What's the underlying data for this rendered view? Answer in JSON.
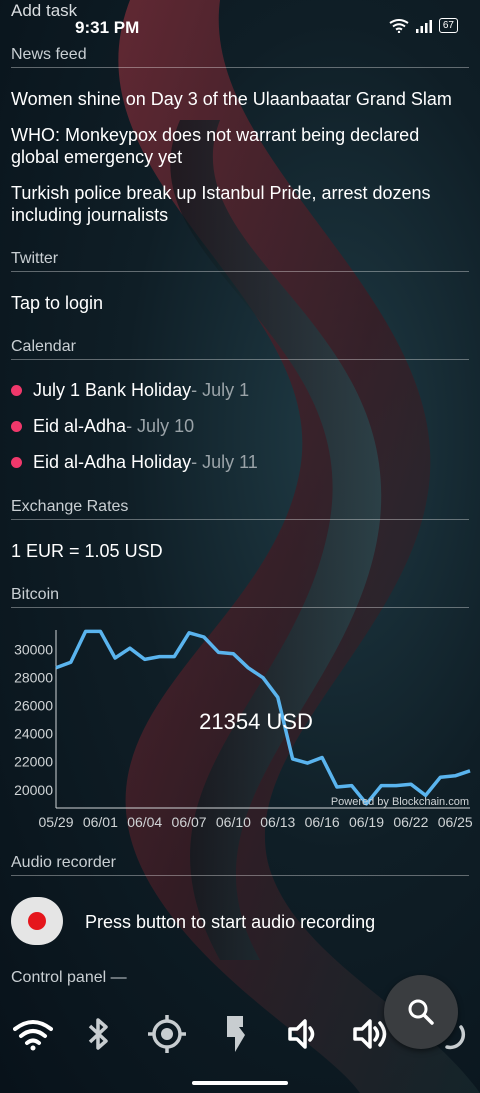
{
  "status_bar": {
    "time": "9:31 PM",
    "battery": "67"
  },
  "add_task": "Add task",
  "news": {
    "title": "News feed",
    "items": [
      "Women shine on Day 3 of the Ulaanbaatar Grand Slam",
      "WHO: Monkeypox does not warrant being declared global emergency yet",
      "Turkish police break up Istanbul Pride, arrest dozens including journalists"
    ]
  },
  "twitter": {
    "title": "Twitter",
    "login": "Tap to login"
  },
  "calendar": {
    "title": "Calendar",
    "events": [
      {
        "name": "July 1 Bank Holiday",
        "date": " - July 1"
      },
      {
        "name": "Eid al-Adha",
        "date": " - July 10"
      },
      {
        "name": "Eid al-Adha Holiday",
        "date": " - July 11"
      }
    ],
    "dot_color": "#f0386b"
  },
  "exchange": {
    "title": "Exchange Rates",
    "rate": "1 EUR = 1.05 USD"
  },
  "bitcoin": {
    "title": "Bitcoin",
    "current": "21354 USD",
    "powered_by": "Powered by Blockchain.com",
    "line_color": "#5ab4ee"
  },
  "chart_data": {
    "type": "line",
    "x": [
      "05/29",
      "05/30",
      "05/31",
      "06/01",
      "06/02",
      "06/03",
      "06/04",
      "06/05",
      "06/06",
      "06/07",
      "06/08",
      "06/09",
      "06/10",
      "06/11",
      "06/12",
      "06/13",
      "06/14",
      "06/15",
      "06/16",
      "06/17",
      "06/18",
      "06/19",
      "06/20",
      "06/21",
      "06/22",
      "06/23",
      "06/24",
      "06/25",
      "06/26"
    ],
    "values": [
      28700,
      29100,
      31300,
      31300,
      29400,
      30100,
      29300,
      29500,
      29500,
      31200,
      30900,
      29800,
      29700,
      28700,
      28000,
      26600,
      22200,
      21900,
      22300,
      20200,
      20300,
      19000,
      20300,
      20300,
      20400,
      19600,
      20900,
      21000,
      21354
    ],
    "xticks": [
      "05/29",
      "06/01",
      "06/04",
      "06/07",
      "06/10",
      "06/13",
      "06/16",
      "06/19",
      "06/22",
      "06/25"
    ],
    "yticks": [
      "30000",
      "28000",
      "26000",
      "24000",
      "22000",
      "20000"
    ],
    "ylim": [
      18700,
      31400
    ],
    "grid": false
  },
  "audio": {
    "title": "Audio recorder",
    "prompt": "Press button to start audio recording"
  },
  "control_panel": {
    "title": "Control panel —",
    "icons": [
      "wifi-icon",
      "bluetooth-icon",
      "location-icon",
      "flashlight-icon",
      "volume-low-icon",
      "volume-high-icon",
      "rotate-icon"
    ]
  },
  "fab_icon": "search-icon"
}
